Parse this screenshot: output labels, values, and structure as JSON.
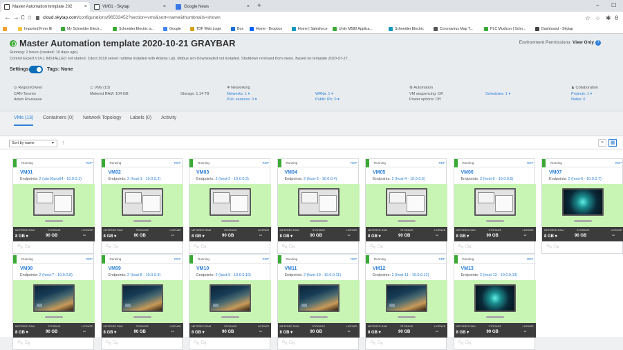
{
  "browser": {
    "tabs": [
      {
        "label": "Master Automation template 202",
        "icon": "skytap-icon"
      },
      {
        "label": "VM01 - Skytap",
        "icon": "skytap-icon"
      },
      {
        "label": "Google News",
        "icon": "google-news-icon"
      }
    ],
    "new_tab": "+",
    "window_controls": {
      "minimize": "–",
      "maximize": "☐"
    },
    "nav": {
      "back": "←",
      "forward": "→",
      "reload": "C",
      "home": "⌂"
    },
    "url_host": "cloud.skytap.com",
    "url_path": "/configurations/96533452?section=vms&sort=name&thumbnails=shown",
    "bookmarks": [
      {
        "label": "",
        "color": "#f0a030"
      },
      {
        "label": "Imported From IE",
        "color": "#f3c744"
      },
      {
        "label": "My Schneider Electr...",
        "color": "#3aaa35"
      },
      {
        "label": "Schneider Electric is...",
        "color": "#3aaa35"
      },
      {
        "label": "Google",
        "color": "#4285f4"
      },
      {
        "label": "TDF Web Login",
        "color": "#d4a017"
      },
      {
        "label": "Box",
        "color": "#1a6fd6"
      },
      {
        "label": "Home - Dropbox",
        "color": "#0061fe"
      },
      {
        "label": "Home | Salesforce",
        "color": "#1798c1"
      },
      {
        "label": "Unity M580 Applica...",
        "color": "#3aaa35"
      },
      {
        "label": "Schneider Electric",
        "color": "#1798c1"
      },
      {
        "label": "Coronavirus Map T...",
        "color": "#555555"
      },
      {
        "label": "PLC Modicon | Schn...",
        "color": "#3aaa35"
      },
      {
        "label": "Dashboard - Skytap",
        "color": "#444444"
      }
    ]
  },
  "env": {
    "title": "Master Automation template 2020-10-21 GRAYBAR",
    "permissions_label": "Environment Permissions:",
    "permissions_value": "View Only",
    "running": "Running: 2 hours (created: 10 days ago)",
    "description": "Control Expert V14.1 INSTALLED not started. Citect 2018 server runtime installed with Adams Lab, Mdbus sim Downloaded not installed. Shutdown removed from menu. Based on template 2020-07-27.",
    "settings_label": "Settings:",
    "tags_label": "Tags: None"
  },
  "info": {
    "region": {
      "header": "Region/Owner",
      "lines": [
        "CAN-Toronto",
        "Adam Rousseau"
      ]
    },
    "vms": {
      "header": "VMs (13)",
      "ram": "Metered RAM: 104 GB",
      "storage": "Storage: 1.14 TB"
    },
    "networking": {
      "header": "Networking",
      "networks": "Networks: 1",
      "wans": "WANs: 1",
      "pub_services": "Pub. services: 0",
      "public_ips": "Public IPs: 0"
    },
    "automation": {
      "header": "Automation",
      "vm_seq": "VM sequencing: Off",
      "power": "Power options: Off",
      "schedules": "Schedules: 1"
    },
    "collab": {
      "header": "Collaboration",
      "projects": "Projects: 1",
      "notes": "Notes: 0"
    }
  },
  "nav_tabs": [
    "VMs (13)",
    "Containers (0)",
    "Network Topology",
    "Labels (0)",
    "Activity"
  ],
  "toolbar": {
    "sort_label": "Sort by name",
    "sort_caret": "▾",
    "sort_dir": "↑"
  },
  "card_labels": {
    "status": "Running",
    "rdp": "RDP",
    "endpoints_label": "Endpoints:",
    "metered_ram": "METERED RAM",
    "storage": "STORAGE",
    "license": "LICENSE",
    "ram_value": "8 GB ▾",
    "storage_value": "90 GB",
    "license_value": "--"
  },
  "vms": [
    {
      "name": "VM01",
      "endpoints": "2 (win10pro64 - 10.0.0.1)",
      "screen": "grid"
    },
    {
      "name": "VM02",
      "endpoints": "2 (host-1 - 10.0.0.2)",
      "screen": "grid"
    },
    {
      "name": "VM03",
      "endpoints": "2 (host-2 - 10.0.0.3)",
      "screen": "grid"
    },
    {
      "name": "VM04",
      "endpoints": "2 (host-3 - 10.0.0.4)",
      "screen": "grid"
    },
    {
      "name": "VM05",
      "endpoints": "2 (host-4 - 10.0.0.5)",
      "screen": "grid"
    },
    {
      "name": "VM06",
      "endpoints": "2 (host-5 - 10.0.0.6)",
      "screen": "grid"
    },
    {
      "name": "VM07",
      "endpoints": "2 (host-6 - 10.0.0.7)",
      "screen": "nebula"
    },
    {
      "name": "VM08",
      "endpoints": "2 (host-7 - 10.0.0.8)",
      "screen": "scene"
    },
    {
      "name": "VM09",
      "endpoints": "2 (host-8 - 10.0.0.9)",
      "screen": "scene"
    },
    {
      "name": "VM10",
      "endpoints": "2 (host-9 - 10.0.0.10)",
      "screen": "scene"
    },
    {
      "name": "VM11",
      "endpoints": "2 (host-10 - 10.0.0.11)",
      "screen": "scene"
    },
    {
      "name": "VM12",
      "endpoints": "2 (host-11 - 10.0.0.12)",
      "screen": "scene"
    },
    {
      "name": "VM13",
      "endpoints": "2 (host-12 - 10.0.0.13)",
      "screen": "nebula"
    }
  ]
}
